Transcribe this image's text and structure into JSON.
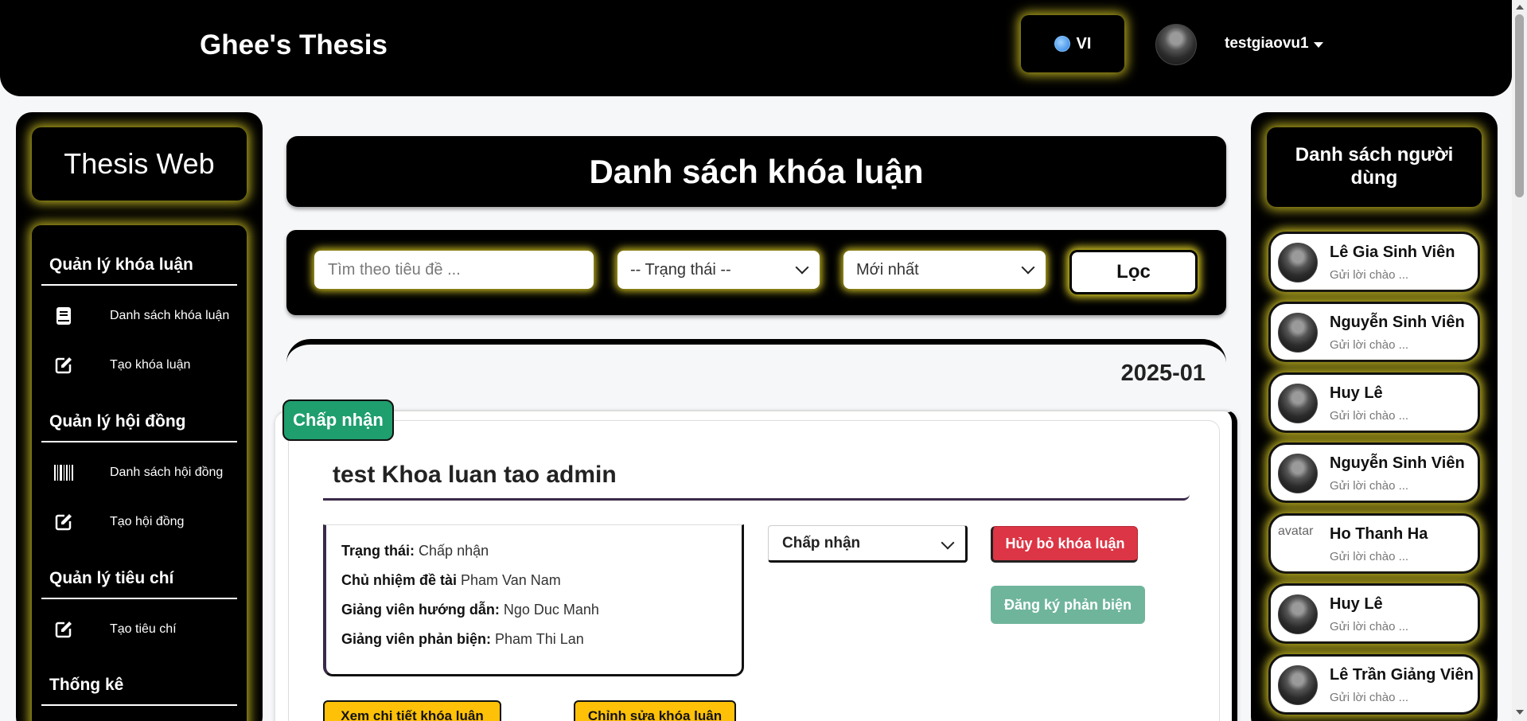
{
  "header": {
    "brand": "Ghee's Thesis",
    "language": "VI",
    "language_icon": "globe-icon",
    "username": "testgiaovu1"
  },
  "left_sidebar": {
    "title": "Thesis Web",
    "sections": [
      {
        "title": "Quản lý khóa luận",
        "items": [
          {
            "label": "Danh sách khóa luận",
            "icon": "book-icon"
          },
          {
            "label": "Tạo khóa luận",
            "icon": "edit-icon"
          }
        ]
      },
      {
        "title": "Quản lý hội đồng",
        "items": [
          {
            "label": "Danh sách hội đồng",
            "icon": "barcode-icon"
          },
          {
            "label": "Tạo hội đồng",
            "icon": "edit-icon"
          }
        ]
      },
      {
        "title": "Quản lý tiêu chí",
        "items": [
          {
            "label": "Tạo tiêu chí",
            "icon": "edit-icon"
          }
        ]
      },
      {
        "title": "Thống kê",
        "items": []
      }
    ]
  },
  "main": {
    "title": "Danh sách khóa luận",
    "filters": {
      "search_placeholder": "Tìm theo tiêu đề ...",
      "status_selected": "-- Trạng thái --",
      "sort_selected": "Mới nhất",
      "filter_button": "Lọc"
    },
    "group_label": "2025-01",
    "thesis": {
      "badge": "Chấp nhận",
      "title": "test Khoa luan tao admin",
      "fields": [
        {
          "label": "Trạng thái:",
          "value": "Chấp nhận"
        },
        {
          "label": "Chủ nhiệm đề tài",
          "value": "Pham Van Nam"
        },
        {
          "label": "Giảng viên hướng dẫn:",
          "value": "Ngo Duc Manh"
        },
        {
          "label": "Giảng viên phản biện:",
          "value": "Pham Thi Lan"
        }
      ],
      "status_select": "Chấp nhận",
      "cancel_button": "Hủy bỏ khóa luận",
      "review_button": "Đăng ký phản biện",
      "detail_button": "Xem chi tiết khóa luận",
      "edit_button": "Chỉnh sửa khóa luận"
    }
  },
  "right_sidebar": {
    "title": "Danh sách người dùng",
    "users": [
      {
        "name": "Lê Gia Sinh Viên",
        "message": "Gửi lời chào ..."
      },
      {
        "name": "Nguyễn Sinh Viên",
        "message": "Gửi lời chào ..."
      },
      {
        "name": "Huy Lê",
        "message": "Gửi lời chào ..."
      },
      {
        "name": "Nguyễn Sinh Viên",
        "message": "Gửi lời chào ..."
      },
      {
        "name": "Ho Thanh Ha",
        "message": "Gửi lời chào ...",
        "avatar_alt": "avatar"
      },
      {
        "name": "Huy Lê",
        "message": "Gửi lời chào ..."
      },
      {
        "name": "Lê Trần Giảng Viên",
        "message": "Gửi lời chào ..."
      }
    ]
  },
  "colors": {
    "glow": "#ebdc28",
    "accept_badge": "#1f9e6e",
    "danger": "#dc3545",
    "success_light": "#6fb59c",
    "warning": "#ffc107"
  }
}
